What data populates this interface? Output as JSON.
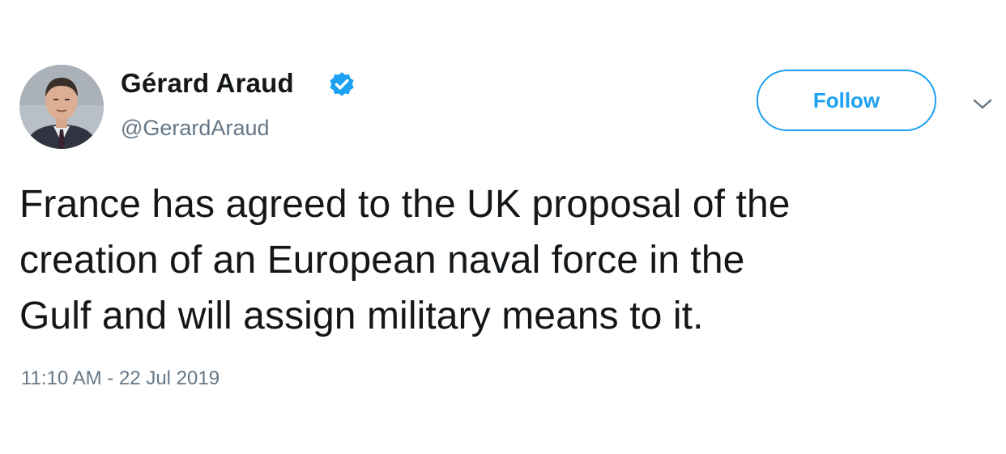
{
  "author": {
    "display_name": "Gérard Araud",
    "handle": "@GerardAraud",
    "verified": true,
    "avatar_icon": "profile-photo"
  },
  "actions": {
    "follow_label": "Follow",
    "menu_icon": "chevron-down-icon"
  },
  "tweet": {
    "text_lines": [
      "France has agreed to the UK proposal of the",
      "creation of an European naval force in the",
      "Gulf and will assign military means to it."
    ],
    "timestamp": "11:10 AM - 22 Jul 2019"
  },
  "colors": {
    "accent": "#1da1f2",
    "text_primary": "#14171a",
    "text_secondary": "#657786",
    "background": "#ffffff"
  }
}
